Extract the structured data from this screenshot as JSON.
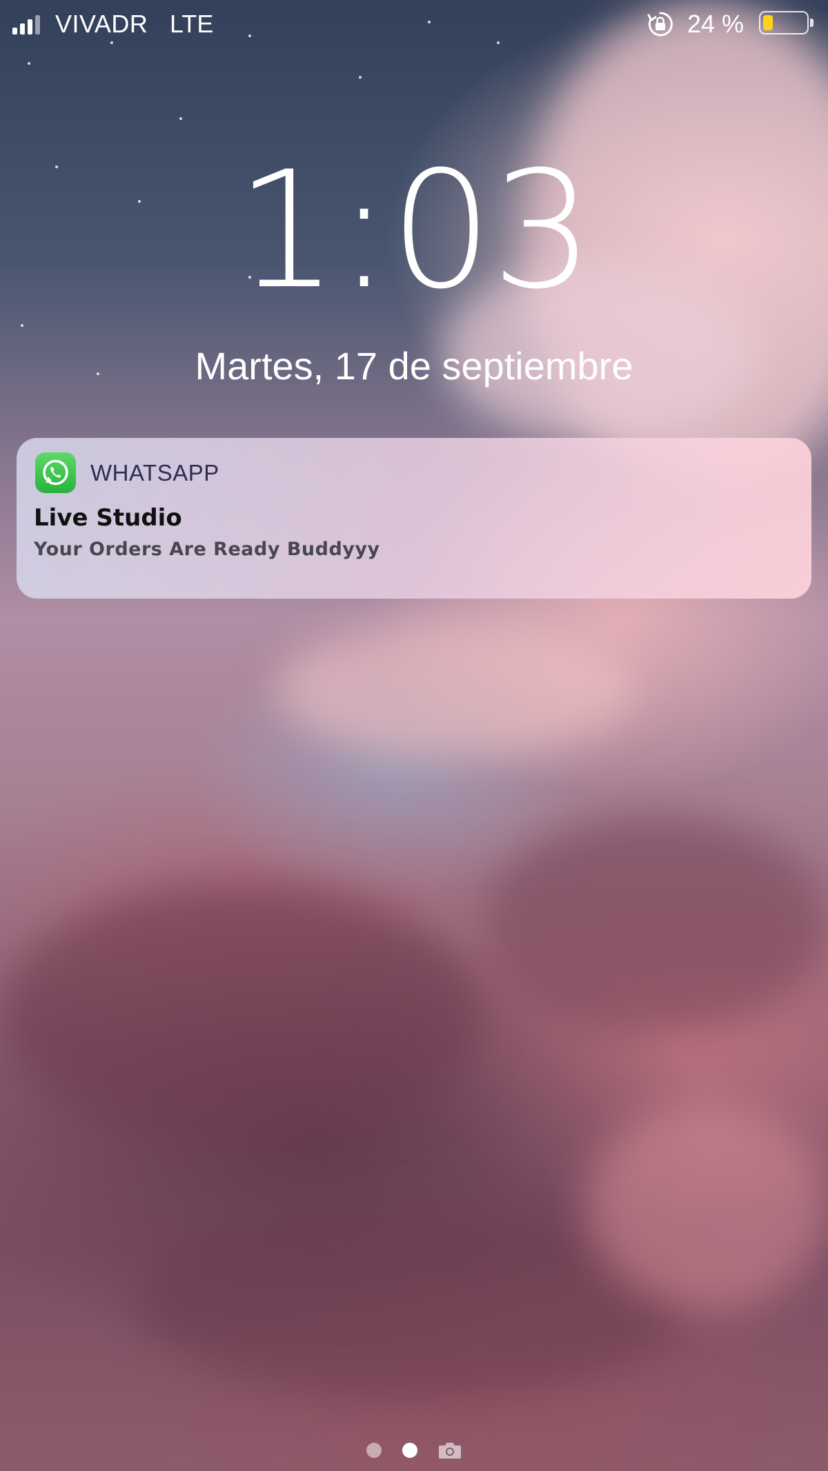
{
  "status_bar": {
    "carrier": "VIVADR",
    "network": "LTE",
    "battery_percent_label": "24 %",
    "battery_level": 0.24,
    "battery_color": "#ffd21e",
    "signal_bars": 4,
    "icons": [
      "signal-bars-icon",
      "rotation-lock-icon",
      "battery-icon"
    ]
  },
  "lock_screen": {
    "time": "1:03",
    "date": "Martes, 17 de septiembre"
  },
  "notification": {
    "app_icon": "whatsapp-icon",
    "app_name": "WHATSAPP",
    "title": "Live Studio",
    "body": "Your Orders Are Ready Buddyyy",
    "accent_color": "#2fbe4a"
  },
  "page_indicator": {
    "dots": 2,
    "active_index": 1,
    "trailing_icon": "camera-icon"
  }
}
